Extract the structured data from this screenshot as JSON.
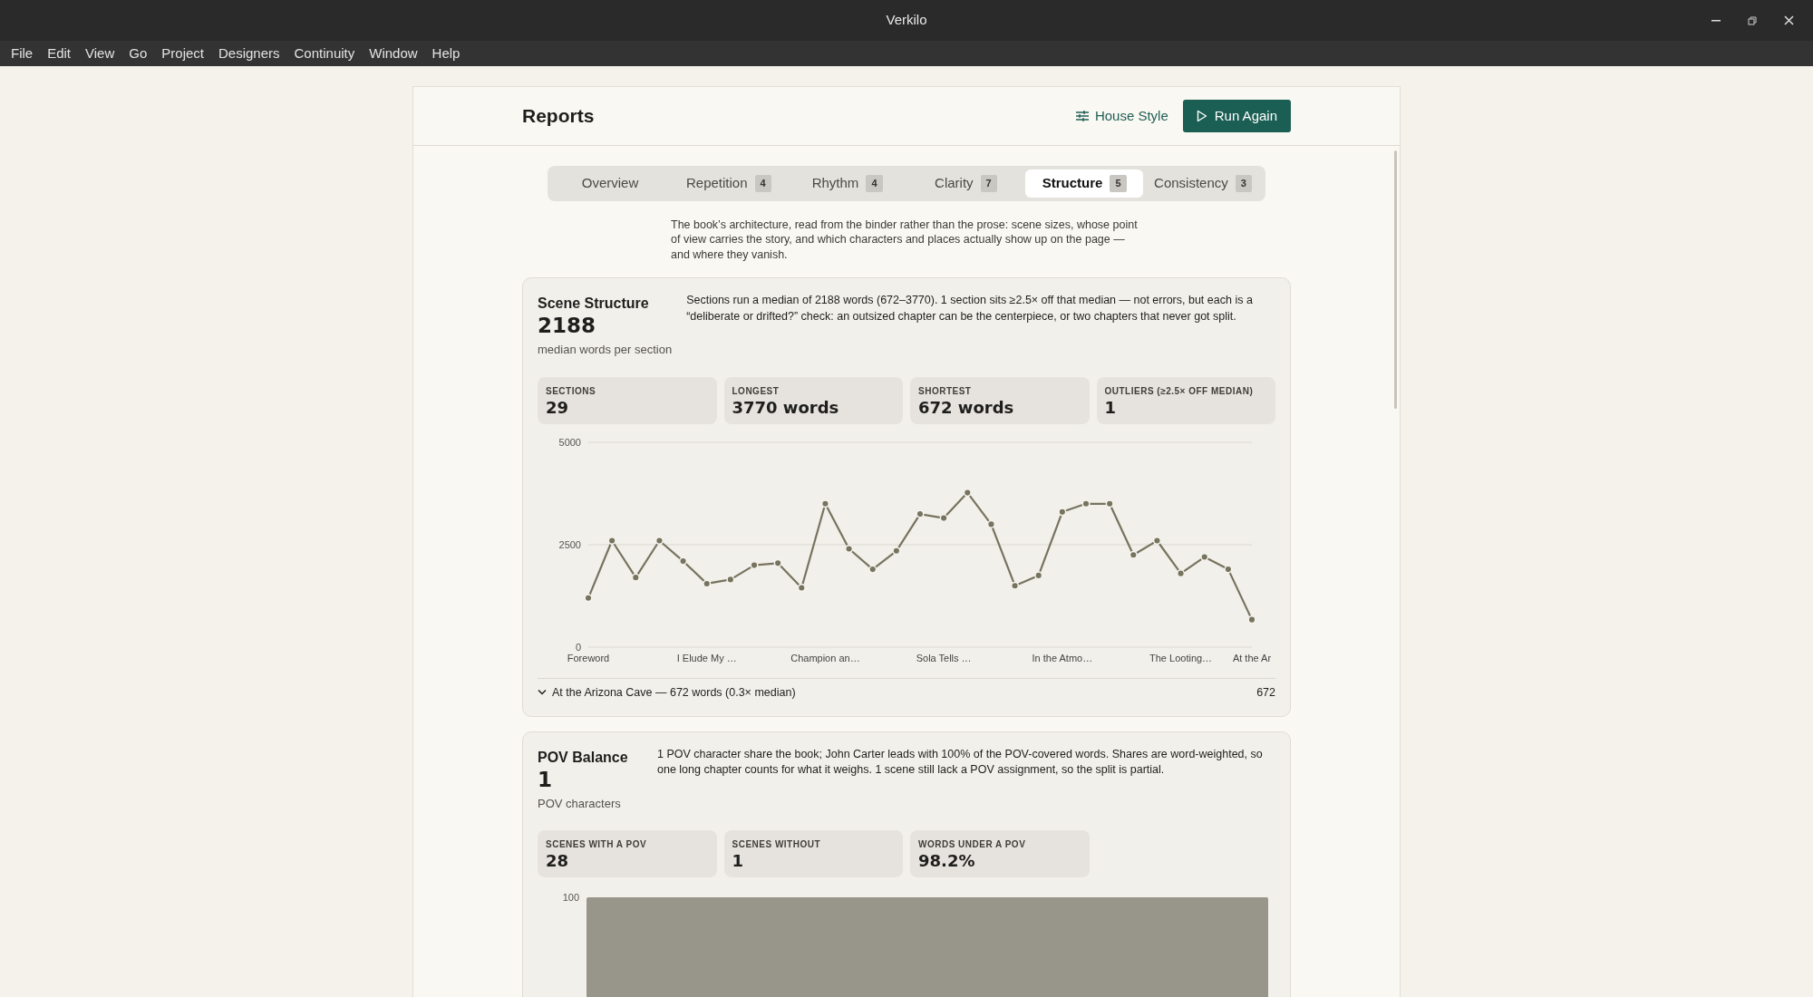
{
  "window": {
    "title": "Verkilo"
  },
  "menu": [
    "File",
    "Edit",
    "View",
    "Go",
    "Project",
    "Designers",
    "Continuity",
    "Window",
    "Help"
  ],
  "header": {
    "title": "Reports",
    "buttons": [
      {
        "label": "House Style",
        "kind": "link"
      },
      {
        "label": "Run Again",
        "kind": "primary"
      }
    ]
  },
  "tabs": [
    {
      "label": "Overview",
      "selected": false
    },
    {
      "label": "Repetition",
      "count": "4",
      "selected": false
    },
    {
      "label": "Rhythm",
      "count": "4",
      "selected": false
    },
    {
      "label": "Clarity",
      "count": "7",
      "selected": false
    },
    {
      "label": "Structure",
      "count": "5",
      "selected": true
    },
    {
      "label": "Consistency",
      "count": "3",
      "selected": false
    }
  ],
  "description": "The book’s architecture, read from the binder rather than the prose: scene sizes, whose point of view carries the story, and which characters and places actually show up on the page — and where they vanish.",
  "sections": [
    {
      "title": "Scene Structure",
      "value": "2188",
      "caption": "median words per section",
      "summary": "Sections run a median of 2188 words (672–3770). 1 section sits ≥2.5× off that median — not errors, but each is a “deliberate or drifted?” check: an outsized chapter can be the centerpiece, or two chapters that never got split.",
      "stats": [
        {
          "label": "SECTIONS",
          "value": "29"
        },
        {
          "label": "LONGEST",
          "value": "3770 words"
        },
        {
          "label": "SHORTEST",
          "value": "672 words"
        },
        {
          "label": "OUTLIERS (≥2.5× OFF MEDIAN)",
          "value": "1"
        }
      ],
      "chart_data": {
        "type": "line",
        "marker": true,
        "ylim": [
          0,
          5000
        ],
        "yticks": [
          0,
          2500,
          5000
        ],
        "values": [
          1200,
          2600,
          1700,
          2600,
          2100,
          1550,
          1650,
          2000,
          2050,
          1450,
          3500,
          2400,
          1900,
          2350,
          3250,
          3150,
          3770,
          3000,
          1500,
          1750,
          3300,
          3500,
          3500,
          2250,
          2600,
          1800,
          2200,
          1900,
          672
        ],
        "categories": [
          "Foreword",
          null,
          null,
          null,
          null,
          "I Elude My …",
          null,
          null,
          null,
          null,
          "Champion an…",
          null,
          null,
          null,
          null,
          "Sola Tells …",
          null,
          null,
          null,
          null,
          "In the Atmo…",
          null,
          null,
          null,
          null,
          "The Looting…",
          null,
          null,
          "At the Ar"
        ]
      },
      "footer": {
        "expanded": true,
        "text": "At the Arizona Cave — 672 words (0.3× median)",
        "value": "672"
      }
    },
    {
      "title": "POV Balance",
      "value": "1",
      "caption": "POV characters",
      "summary": "1 POV character share the book; John Carter leads with 100% of the POV-covered words. Shares are word-weighted, so one long chapter counts for what it weighs. 1 scene still lack a POV assignment, so the split is partial.",
      "stats": [
        {
          "label": "SCENES WITH A POV",
          "value": "28"
        },
        {
          "label": "SCENES WITHOUT",
          "value": "1"
        },
        {
          "label": "WORDS UNDER A POV",
          "value": "98.2%"
        }
      ],
      "bar_chart": {
        "ytick": "100"
      }
    }
  ]
}
